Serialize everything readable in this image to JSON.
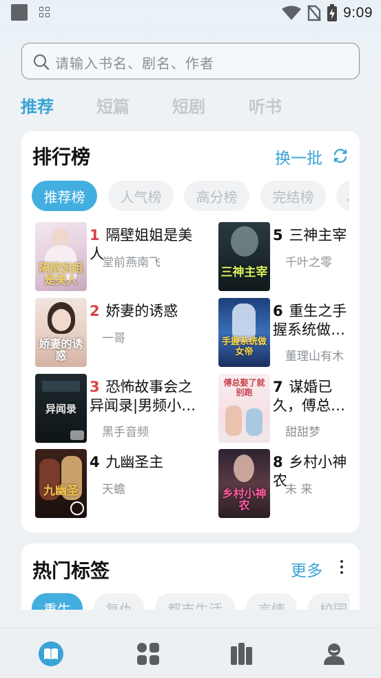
{
  "status_bar": {
    "time": "9:09"
  },
  "search": {
    "placeholder": "请输入书名、剧名、作者"
  },
  "top_tabs": [
    "推荐",
    "短篇",
    "短剧",
    "听书"
  ],
  "ranking": {
    "title": "排行榜",
    "refresh_label": "换一批",
    "chips": [
      "推荐榜",
      "人气榜",
      "高分榜",
      "完结榜",
      "…"
    ],
    "books": [
      {
        "rank": "1",
        "title": "隔壁姐姐是美人",
        "author": "堂前燕南飞",
        "cover_text": "隔壁姐姐是美人"
      },
      {
        "rank": "2",
        "title": "娇妻的诱惑",
        "author": "一哥",
        "cover_text": "娇妻的诱惑"
      },
      {
        "rank": "3",
        "title": "恐怖故事会之异闻录|男频小说...",
        "author": "黑手音频",
        "cover_text": "异闻录"
      },
      {
        "rank": "4",
        "title": "九幽圣主",
        "author": "天蟾",
        "cover_text": "九幽圣"
      },
      {
        "rank": "5",
        "title": "三神主宰",
        "author": "千叶之零",
        "cover_text": "三神主宰"
      },
      {
        "rank": "6",
        "title": "重生之手握系统做女帝",
        "author": "董理山有木",
        "cover_text": "手握系统做女帝"
      },
      {
        "rank": "7",
        "title": "谋婚已久，傅总，娶了就别跑",
        "author": "甜甜梦",
        "cover_text": "傅总娶了就别跑"
      },
      {
        "rank": "8",
        "title": "乡村小神农",
        "author": "未 来",
        "cover_text": "乡村小神农"
      }
    ]
  },
  "tags": {
    "title": "热门标签",
    "more_label": "更多",
    "chips": [
      "重生",
      "复仇",
      "都市生活",
      "言情",
      "校园"
    ]
  },
  "colors": {
    "accent": "#3aa3d6",
    "rank_top": "#d94343"
  },
  "bottom_nav": [
    "book-icon",
    "category-grid-icon",
    "bookshelf-icon",
    "profile-icon"
  ]
}
